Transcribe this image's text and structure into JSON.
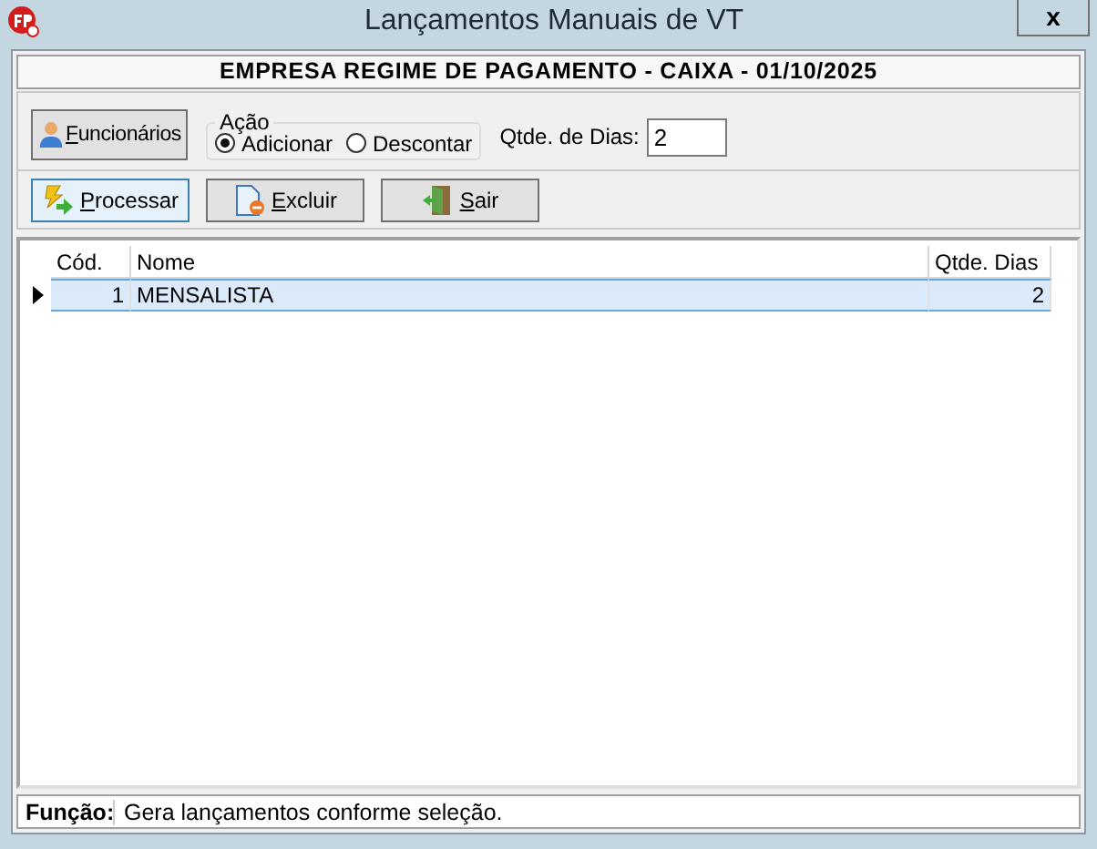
{
  "window": {
    "title": "Lançamentos Manuais de VT",
    "close": "x"
  },
  "header": "EMPRESA REGIME DE PAGAMENTO - CAIXA - 01/10/2025",
  "employees_button": "Funcionários",
  "action_group": {
    "legend": "Ação",
    "options": [
      {
        "label": "Adicionar",
        "selected": true
      },
      {
        "label": "Descontar",
        "selected": false
      }
    ]
  },
  "days_field": {
    "label": "Qtde. de Dias:",
    "value": "2"
  },
  "buttons": [
    {
      "label": "Processar",
      "kind": "process",
      "focused": true
    },
    {
      "label": "Excluir",
      "kind": "delete",
      "focused": false
    },
    {
      "label": "Sair",
      "kind": "exit",
      "focused": false
    }
  ],
  "table": {
    "columns": [
      "Cód.",
      "Nome",
      "Qtde. Dias"
    ],
    "rows": [
      {
        "cells": [
          "1",
          "MENSALISTA",
          "2"
        ],
        "selected": true
      }
    ]
  },
  "status_bar": {
    "label": "Função:",
    "text": "Gera lançamentos conforme seleção."
  }
}
